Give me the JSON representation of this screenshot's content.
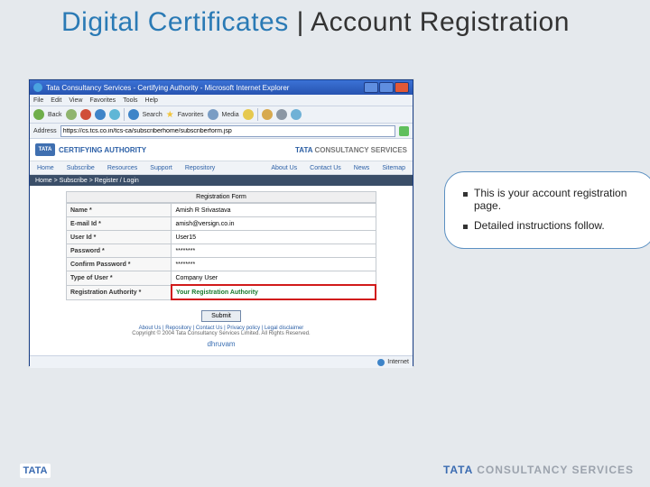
{
  "slide": {
    "title_left": "Digital Certificates",
    "title_sep": " | ",
    "title_right": "Account Registration"
  },
  "browser": {
    "window_title": "Tata Consultancy Services - Certifying Authority - Microsoft Internet Explorer",
    "menu": [
      "File",
      "Edit",
      "View",
      "Favorites",
      "Tools",
      "Help"
    ],
    "toolbar": {
      "back": "Back",
      "search": "Search",
      "favorites": "Favorites",
      "media": "Media"
    },
    "address_label": "Address",
    "url": "https://cs.tcs.co.in/tcs-ca/subscriberhome/subscriberform.jsp",
    "status_right": "Internet"
  },
  "page": {
    "brand": "TATA",
    "heading": "CERTIFYING AUTHORITY",
    "tcs_a": "TATA ",
    "tcs_b": "CONSULTANCY SERVICES",
    "nav": [
      "Home",
      "Subscribe",
      "Resources",
      "Support",
      "Repository"
    ],
    "nav_right": [
      "About Us",
      "Contact Us",
      "News",
      "Sitemap"
    ],
    "breadcrumb": "Home > Subscribe > Register / Login",
    "form_title": "Registration Form",
    "fields": {
      "name": {
        "label": "Name *",
        "value": "Amish R Srivastava"
      },
      "email": {
        "label": "E-mail Id *",
        "value": "amish@versign.co.in"
      },
      "userid": {
        "label": "User Id *",
        "value": "User15"
      },
      "password": {
        "label": "Password *",
        "value": "********"
      },
      "confirm": {
        "label": "Confirm Password *",
        "value": "********"
      },
      "type": {
        "label": "Type of User *",
        "value": "Company User"
      },
      "ra": {
        "label": "Registration Authority *",
        "value": "Your Registration Authority"
      }
    },
    "submit": "Submit",
    "footer_links": "About Us | Repository | Contact Us | Privacy policy | Legal disclaimer",
    "copyright": "Copyright © 2004 Tata Consultancy Services Limited. All Rights Reserved.",
    "powered": "dhruvam"
  },
  "callout": {
    "items": [
      "This is your account registration page.",
      "Detailed instructions follow."
    ]
  },
  "footer": {
    "logo": "TATA",
    "brand_a": "TATA ",
    "brand_b": "CONSULTANCY SERVICES"
  }
}
